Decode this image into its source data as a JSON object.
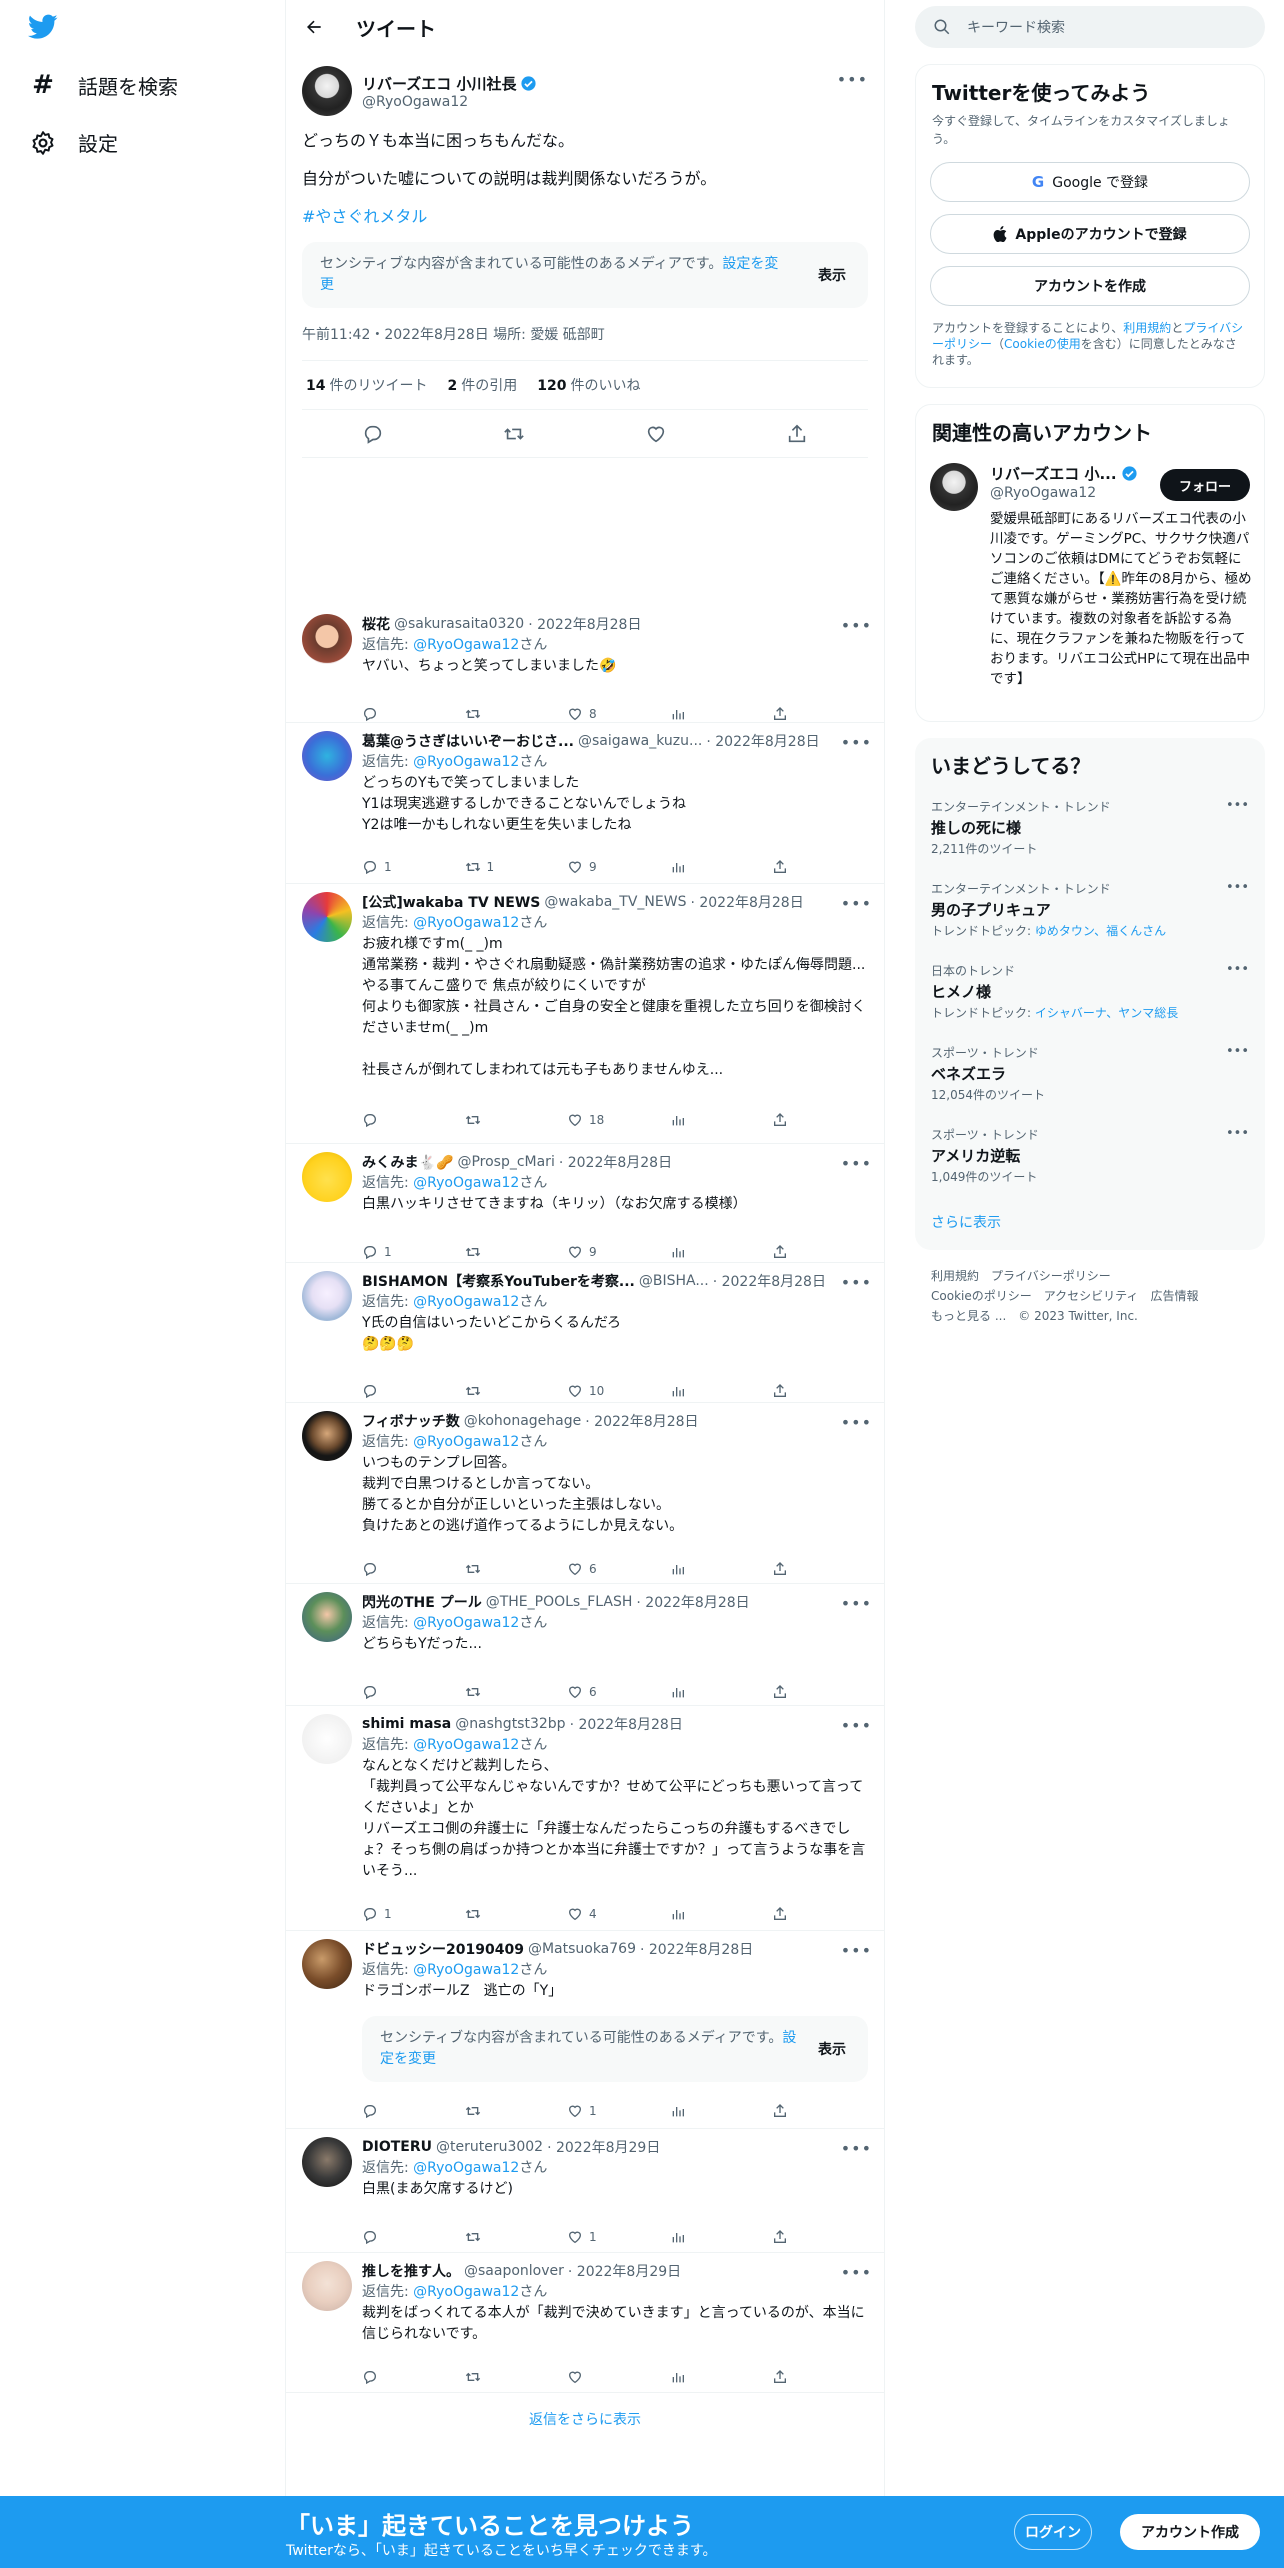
{
  "nav": {
    "explore": "話題を検索",
    "settings": "設定"
  },
  "header": {
    "title": "ツイート"
  },
  "focal": {
    "name": "リバーズエコ 小川社長",
    "handle": "@RyoOgawa12",
    "line1": "どっちのＹも本当に困っちもんだな。",
    "line2": "自分がついた嘘についての説明は裁判関係ないだろうが。",
    "hashtag": "#やさぐれメタル",
    "sensitive_text": "センシティブな内容が含まれている可能性のあるメディアです。",
    "sensitive_link": "設定を変更",
    "show": "表示",
    "meta": "午前11:42・2022年8月28日 場所: 愛媛 砥部町",
    "retweets": "14",
    "retweets_label": "件のリツイート",
    "quotes": "2",
    "quotes_label": "件の引用",
    "likes": "120",
    "likes_label": "件のいいね"
  },
  "reply_prefix": "返信先: ",
  "reply_suffix": "さん",
  "reply_to": "@RyoOgawa12",
  "replies": [
    {
      "name": "桜花",
      "handle": "@sakurasaita0320",
      "date": "· 2022年8月28日",
      "text": "ヤバい、ちょっと笑ってしまいました🤣",
      "replies": "",
      "retweets": "",
      "likes": "8"
    },
    {
      "name": "葛葉@うさぎはいいぞーおじさ...",
      "handle": "@saigawa_kuzu...",
      "date": "· 2022年8月28日",
      "text": "どっちのYもで笑ってしまいました\nY1は現実逃避するしかできることないんでしょうね\nY2は唯一かもしれない更生を失いましたね",
      "replies": "1",
      "retweets": "1",
      "likes": "9"
    },
    {
      "name": "[公式]wakaba TV NEWS",
      "handle": "@wakaba_TV_NEWS",
      "date": "· 2022年8月28日",
      "text": "お疲れ様ですm(_ _)m\n通常業務・裁判・やさぐれ扇動疑惑・偽計業務妨害の追求・ゆたぽん侮辱問題...\nやる事てんこ盛りで 焦点が絞りにくいですが\n何よりも御家族・社員さん・ご自身の安全と健康を重視した立ち回りを御検討くださいませm(_ _)m\n\n社長さんが倒れてしまわれては元も子もありませんゆえ...",
      "replies": "",
      "retweets": "",
      "likes": "18"
    },
    {
      "name": "みくみま🐇🥜",
      "handle": "@Prosp_cMari",
      "date": "· 2022年8月28日",
      "text": "白黒ハッキリさせてきますね（キリッ）（なお欠席する模様）",
      "replies": "1",
      "retweets": "",
      "likes": "9"
    },
    {
      "name": "BISHAMON【考察系YouTuberを考察...",
      "handle": "@BISHA...",
      "date": "· 2022年8月28日",
      "text": "Y氏の自信はいったいどこからくるんだろ\n🤔🤔🤔",
      "replies": "",
      "retweets": "",
      "likes": "10"
    },
    {
      "name": "フィボナッチ数",
      "handle": "@kohonagehage",
      "date": "· 2022年8月28日",
      "text": "いつものテンプレ回答。\n裁判で白黒つけるとしか言ってない。\n勝てるとか自分が正しいといった主張はしない。\n負けたあとの逃げ道作ってるようにしか見えない。",
      "replies": "",
      "retweets": "",
      "likes": "6"
    },
    {
      "name": "閃光のTHE プール",
      "handle": "@THE_POOLs_FLASH",
      "date": "· 2022年8月28日",
      "text": "どちらもYだった...",
      "replies": "",
      "retweets": "",
      "likes": "6"
    },
    {
      "name": "shimi masa",
      "handle": "@nashgtst32bp",
      "date": "· 2022年8月28日",
      "text": "なんとなくだけど裁判したら、\n「裁判員って公平なんじゃないんですか？せめて公平にどっちも悪いって言ってくださいよ」とか\nリバーズエコ側の弁護士に「弁護士なんだったらこっちの弁護もするべきでしょ？そっち側の肩ばっか持つとか本当に弁護士ですか？」って言うような事を言いそう...",
      "replies": "1",
      "retweets": "",
      "likes": "4"
    },
    {
      "name": "ドビュッシー20190409",
      "handle": "@Matsuoka769",
      "date": "· 2022年8月28日",
      "text": "ドラゴンボールZ　逃亡の「Y」",
      "replies": "",
      "retweets": "",
      "likes": "1"
    },
    {
      "name": "DIOTERU",
      "handle": "@teruteru3002",
      "date": "· 2022年8月29日",
      "text": "白黒(まあ欠席するけど)",
      "replies": "",
      "retweets": "",
      "likes": "1"
    },
    {
      "name": "推しを推す人。",
      "handle": "@saaponlover",
      "date": "· 2022年8月29日",
      "text": "裁判をばっくれてる本人が「裁判で決めていきます」と言っているのが、本当に信じられないです。",
      "replies": "",
      "retweets": "",
      "likes": ""
    }
  ],
  "reply_sensitive": {
    "text": "センシティブな内容が含まれている可能性のあるメディアです。",
    "link": "設定を変更",
    "show": "表示"
  },
  "more_replies": "返信をさらに表示",
  "search": {
    "placeholder": "キーワード検索"
  },
  "signup": {
    "title": "Twitterを使ってみよう",
    "subtitle": "今すぐ登録して、タイムラインをカスタマイズしましょう。",
    "google": "Google で登録",
    "apple": "Appleのアカウントで登録",
    "create": "アカウントを作成",
    "terms_prefix": "アカウントを登録することにより、",
    "terms_link1": "利用規約",
    "terms_mid1": "と",
    "terms_link2": "プライバシーポリシー",
    "terms_mid2": "（",
    "terms_link3": "Cookieの使用",
    "terms_suffix": "を含む）に同意したとみなされます。"
  },
  "related": {
    "title": "関連性の高いアカウント",
    "name": "リバーズエコ 小...",
    "handle": "@RyoOgawa12",
    "follow": "フォロー",
    "bio": "愛媛県砥部町にあるリバーズエコ代表の小川凌です。ゲーミングPC、サクサク快適パソコンのご依頼はDMにてどうぞお気軽にご連絡ください。【⚠️昨年の8月から、極めて悪質な嫌がらせ・業務妨害行為を受け続けています。複数の対象者を訴訟する為に、現在クラファンを兼ねた物販を行っております。リバエコ公式HPにて現在出品中です】"
  },
  "trends": {
    "title": "いまどうしてる？",
    "items": [
      {
        "category": "エンターテインメント・トレンド",
        "name": "推しの死に様",
        "sub": "2,211件のツイート",
        "topics_label": "",
        "topics": ""
      },
      {
        "category": "エンターテインメント・トレンド",
        "name": "男の子プリキュア",
        "sub": "",
        "topics_label": "トレンドトピック: ",
        "topics": "ゆめタウン、福くんさん"
      },
      {
        "category": "日本のトレンド",
        "name": "ヒメノ様",
        "sub": "",
        "topics_label": "トレンドトピック: ",
        "topics": "イシャバーナ、ヤンマ総長"
      },
      {
        "category": "スポーツ・トレンド",
        "name": "ベネズエラ",
        "sub": "12,054件のツイート",
        "topics_label": "",
        "topics": ""
      },
      {
        "category": "スポーツ・トレンド",
        "name": "アメリカ逆転",
        "sub": "1,049件のツイート",
        "topics_label": "",
        "topics": ""
      }
    ],
    "show_more": "さらに表示"
  },
  "footer": {
    "terms": "利用規約",
    "privacy": "プライバシーポリシー",
    "cookie": "Cookieのポリシー",
    "access": "アクセシビリティ",
    "ads": "広告情報",
    "more": "もっと見る ...",
    "copyright": "© 2023 Twitter, Inc."
  },
  "bottom": {
    "title": "「いま」起きていることを見つけよう",
    "subtitle": "Twitterなら、「いま」起きていることをいち早くチェックできます。",
    "login": "ログイン",
    "signup": "アカウント作成"
  },
  "colors": {
    "accent": "#1d9bf0",
    "text": "#0f1419",
    "secondary": "#536471"
  }
}
